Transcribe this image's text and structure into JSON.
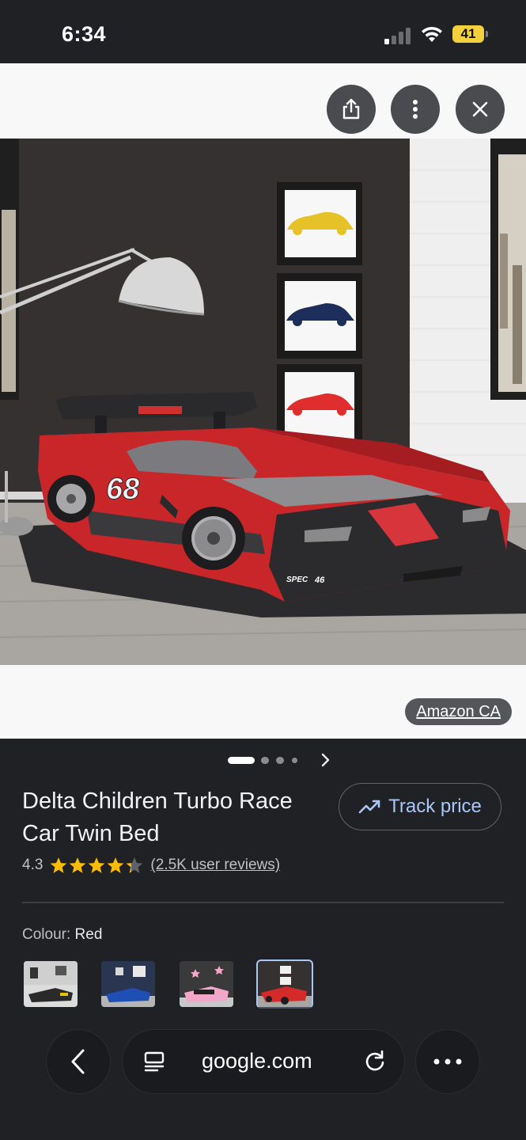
{
  "status_bar": {
    "time": "6:34",
    "battery_level": "41",
    "battery_color": "#f4d03f"
  },
  "viewer": {
    "image_subject": "red race car twin bed in a kids bedroom with framed car prints and a floor lamp",
    "bed_number": "68",
    "source": "Amazon CA",
    "buttons": {
      "share_icon": "share-icon",
      "more_icon": "more-vert-icon",
      "close_icon": "close-icon"
    },
    "pager": {
      "total": 4,
      "active_index": 0
    }
  },
  "product": {
    "title": "Delta Children Turbo Race Car Twin Bed",
    "track_price_label": "Track price",
    "rating_value": "4.3",
    "rating_stars": 4.3,
    "reviews_label": "(2.5K user reviews)",
    "colour_label": "Colour:",
    "colour_value": "Red",
    "variants": [
      {
        "name": "black",
        "accent": "#2a2a2a"
      },
      {
        "name": "blue",
        "accent": "#1f4fb4"
      },
      {
        "name": "pink",
        "accent": "#f2a6c8"
      },
      {
        "name": "red",
        "accent": "#d42a2a",
        "selected": true
      }
    ]
  },
  "browser": {
    "url": "google.com",
    "back_icon": "back-arrow-icon",
    "tabs_icon": "page-menu-icon",
    "reload_icon": "reload-icon",
    "more_icon": "more-horiz-icon"
  },
  "colors": {
    "accent": "#a8c7fa",
    "star": "#fbbc04",
    "background": "#202125"
  }
}
